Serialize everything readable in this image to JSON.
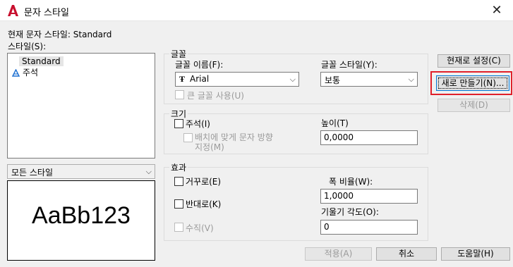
{
  "window": {
    "title": "문자 스타일",
    "close_glyph": "✕"
  },
  "current_style": "현재 문자 스타일: Standard",
  "styles_label": "스타일(S):",
  "styles_list": [
    "Standard",
    "주석"
  ],
  "filter": {
    "value": "모든 스타일"
  },
  "preview_text": "AaBb123",
  "font_group": {
    "title": "글꼴",
    "font_name_label": "글꼴 이름(F):",
    "font_name_value": "Arial",
    "font_style_label": "글꼴 스타일(Y):",
    "font_style_value": "보통",
    "big_font_label": "큰 글꼴 사용(U)"
  },
  "size_group": {
    "title": "크기",
    "annotative_label": "주석(I)",
    "match_orientation_label_1": "배치에 맞게 문자 방향",
    "match_orientation_label_2": "지정(M)",
    "height_label": "높이(T)",
    "height_value": "0,0000"
  },
  "effects_group": {
    "title": "효과",
    "upside_down_label": "거꾸로(E)",
    "backwards_label": "반대로(K)",
    "vertical_label": "수직(V)",
    "width_factor_label": "폭 비율(W):",
    "width_factor_value": "1,0000",
    "oblique_label": "기울기 각도(O):",
    "oblique_value": "0"
  },
  "buttons": {
    "set_current": "현재로 설정(C)",
    "new": "새로 만들기(N)...",
    "delete": "삭제(D)",
    "apply": "적용(A)",
    "cancel": "취소",
    "help": "도움말(H)"
  },
  "colors": {
    "highlight": "#e0202a",
    "autocad_red": "#c8102e"
  }
}
